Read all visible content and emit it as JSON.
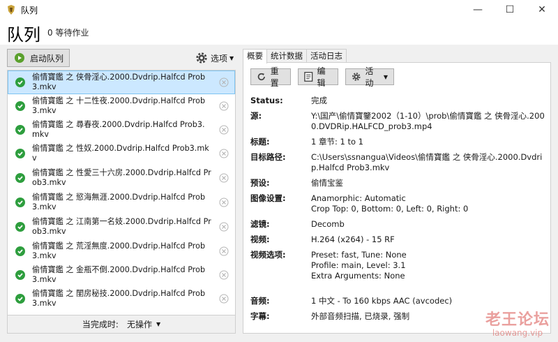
{
  "window": {
    "title": "队列",
    "minimize": "—",
    "maximize": "☐",
    "close": "✕"
  },
  "header": {
    "title": "队列",
    "pending": "0 等待作业"
  },
  "toolbar": {
    "start_label": "启动队列",
    "options_label": "选项"
  },
  "queue": {
    "items": [
      {
        "name": "偷情寶鑑 之 侠骨淫心.2000.Dvdrip.Halfcd Prob3.mkv",
        "status": "complete"
      },
      {
        "name": "偷情寶鑑 之 十二性夜.2000.Dvdrip.Halfcd Prob3.mkv",
        "status": "complete"
      },
      {
        "name": "偷情寶鑑 之 尋春夜.2000.Dvdrip.Halfcd Prob3.mkv",
        "status": "complete"
      },
      {
        "name": "偷情寶鑑 之 性奴.2000.Dvdrip.Halfcd Prob3.mkv",
        "status": "complete"
      },
      {
        "name": "偷情寶鑑 之 性愛三十六房.2000.Dvdrip.Halfcd Prob3.mkv",
        "status": "complete"
      },
      {
        "name": "偷情寶鑑 之 慾海無涯.2000.Dvdrip.Halfcd Prob3.mkv",
        "status": "complete"
      },
      {
        "name": "偷情寶鑑 之 江南第一名妓.2000.Dvdrip.Halfcd Prob3.mkv",
        "status": "complete"
      },
      {
        "name": "偷情寶鑑 之 荒淫無度.2000.Dvdrip.Halfcd Prob3.mkv",
        "status": "complete"
      },
      {
        "name": "偷情寶鑑 之 金瓶不倒.2000.Dvdrip.Halfcd Prob3.mkv",
        "status": "complete"
      },
      {
        "name": "偷情寶鑑 之 閨房秘技.2000.Dvdrip.Halfcd Prob3.mkv",
        "status": "complete"
      }
    ]
  },
  "footer": {
    "when_done_label": "当完成时:",
    "when_done_value": "无操作"
  },
  "tabs": [
    "概要",
    "统计数据",
    "活动日志"
  ],
  "actions": {
    "reset": "重置",
    "edit": "编辑",
    "activity": "活动"
  },
  "details": {
    "status_k": "Status:",
    "status_v": "完成",
    "source_k": "源:",
    "source_v": "Y:\\国产\\偷情寶鑒2002（1-10）\\prob\\偷情寶鑑 之 侠骨淫心.2000.DVDRip.HALFCD_prob3.mp4",
    "title_k": "标题:",
    "title_v": "1   章节:  1 to 1",
    "dest_k": "目标路径:",
    "dest_v": "C:\\Users\\ssnangua\\Videos\\偷情寶鑑 之 侠骨淫心.2000.Dvdrip.Halfcd Prob3.mkv",
    "preset_k": "预设:",
    "preset_v": "偷情宝鉴",
    "picture_k": "图像设置:",
    "picture_v1": "Anamorphic: Automatic",
    "picture_v2": "Crop Top: 0, Bottom: 0, Left: 0, Right: 0",
    "filters_k": "滤镜:",
    "filters_v": "Decomb",
    "video_k": "视频:",
    "video_v": "H.264 (x264) - 15 RF",
    "vopts_k": "视频选项:",
    "vopts_v1": "Preset: fast, Tune: None",
    "vopts_v2": "Profile: main, Level: 3.1",
    "vopts_v3": "Extra Arguments: None",
    "audio_k": "音频:",
    "audio_v": "1 中文 -  To 160 kbps AAC (avcodec)",
    "subs_k": "字幕:",
    "subs_v": "外部音频扫描, 已烧录, 强制"
  },
  "watermark": {
    "line1": "老王论坛",
    "line2": "laowang.vip"
  },
  "colors": {
    "accent": "#cce8ff",
    "check": "#2e9e3e",
    "watermark": "#d9534f"
  }
}
